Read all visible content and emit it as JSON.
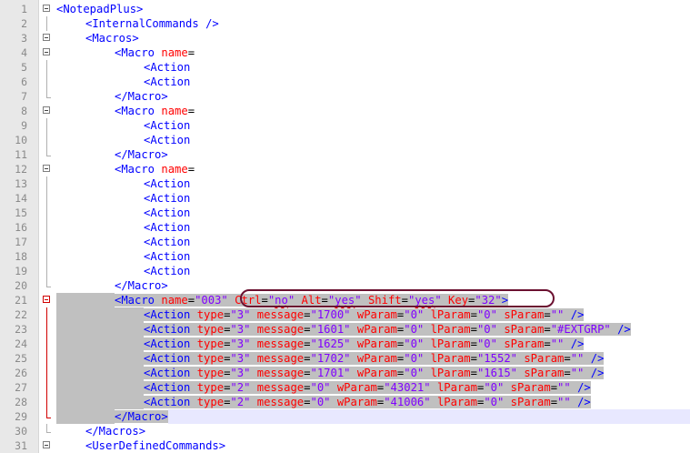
{
  "lines": [
    {
      "n": "1",
      "indent": 0,
      "sel": false,
      "fold": "box",
      "tokens": [
        {
          "t": "<NotepadPlus>",
          "c": "tag"
        }
      ]
    },
    {
      "n": "2",
      "indent": 1,
      "sel": false,
      "fold": "",
      "tokens": [
        {
          "t": "<InternalCommands />",
          "c": "tag"
        }
      ]
    },
    {
      "n": "3",
      "indent": 1,
      "sel": false,
      "fold": "box",
      "tokens": [
        {
          "t": "<Macros>",
          "c": "tag"
        }
      ]
    },
    {
      "n": "4",
      "indent": 2,
      "sel": false,
      "fold": "box",
      "tokens": [
        {
          "t": "<Macro ",
          "c": "tag"
        },
        {
          "t": "name",
          "c": "attr"
        },
        {
          "t": "=",
          "c": "eq"
        }
      ]
    },
    {
      "n": "5",
      "indent": 3,
      "sel": false,
      "fold": "",
      "tokens": [
        {
          "t": "<Action",
          "c": "tag"
        }
      ]
    },
    {
      "n": "6",
      "indent": 3,
      "sel": false,
      "fold": "",
      "tokens": [
        {
          "t": "<Action",
          "c": "tag"
        }
      ]
    },
    {
      "n": "7",
      "indent": 2,
      "sel": false,
      "fold": "end",
      "tokens": [
        {
          "t": "</Macro>",
          "c": "tag"
        }
      ]
    },
    {
      "n": "8",
      "indent": 2,
      "sel": false,
      "fold": "box",
      "tokens": [
        {
          "t": "<Macro ",
          "c": "tag"
        },
        {
          "t": "name",
          "c": "attr"
        },
        {
          "t": "=",
          "c": "eq"
        }
      ]
    },
    {
      "n": "9",
      "indent": 3,
      "sel": false,
      "fold": "",
      "tokens": [
        {
          "t": "<Action",
          "c": "tag"
        }
      ]
    },
    {
      "n": "10",
      "indent": 3,
      "sel": false,
      "fold": "",
      "tokens": [
        {
          "t": "<Action",
          "c": "tag"
        }
      ]
    },
    {
      "n": "11",
      "indent": 2,
      "sel": false,
      "fold": "end",
      "tokens": [
        {
          "t": "</Macro>",
          "c": "tag"
        }
      ]
    },
    {
      "n": "12",
      "indent": 2,
      "sel": false,
      "fold": "box",
      "tokens": [
        {
          "t": "<Macro ",
          "c": "tag"
        },
        {
          "t": "name",
          "c": "attr"
        },
        {
          "t": "=",
          "c": "eq"
        }
      ]
    },
    {
      "n": "13",
      "indent": 3,
      "sel": false,
      "fold": "",
      "tokens": [
        {
          "t": "<Action",
          "c": "tag"
        }
      ]
    },
    {
      "n": "14",
      "indent": 3,
      "sel": false,
      "fold": "",
      "tokens": [
        {
          "t": "<Action",
          "c": "tag"
        }
      ]
    },
    {
      "n": "15",
      "indent": 3,
      "sel": false,
      "fold": "",
      "tokens": [
        {
          "t": "<Action",
          "c": "tag"
        }
      ]
    },
    {
      "n": "16",
      "indent": 3,
      "sel": false,
      "fold": "",
      "tokens": [
        {
          "t": "<Action",
          "c": "tag"
        }
      ]
    },
    {
      "n": "17",
      "indent": 3,
      "sel": false,
      "fold": "",
      "tokens": [
        {
          "t": "<Action",
          "c": "tag"
        }
      ]
    },
    {
      "n": "18",
      "indent": 3,
      "sel": false,
      "fold": "",
      "tokens": [
        {
          "t": "<Action",
          "c": "tag"
        }
      ]
    },
    {
      "n": "19",
      "indent": 3,
      "sel": false,
      "fold": "",
      "tokens": [
        {
          "t": "<Action",
          "c": "tag"
        }
      ]
    },
    {
      "n": "20",
      "indent": 2,
      "sel": false,
      "fold": "end",
      "tokens": [
        {
          "t": "</Macro>",
          "c": "tag"
        }
      ]
    },
    {
      "n": "21",
      "indent": 2,
      "sel": true,
      "fold": "redbox",
      "tokens": [
        {
          "t": "<Macro ",
          "c": "tag"
        },
        {
          "t": "name",
          "c": "attr"
        },
        {
          "t": "=",
          "c": "eq"
        },
        {
          "t": "\"003\"",
          "c": "val"
        },
        {
          "t": " ",
          "c": "eq"
        },
        {
          "t": "Ctrl",
          "c": "attr"
        },
        {
          "t": "=",
          "c": "eq"
        },
        {
          "t": "\"",
          "c": "val"
        },
        {
          "t": "no",
          "c": "val",
          "sq": true
        },
        {
          "t": "\"",
          "c": "val"
        },
        {
          "t": " ",
          "c": "eq"
        },
        {
          "t": "Alt",
          "c": "attr"
        },
        {
          "t": "=",
          "c": "eq"
        },
        {
          "t": "\"",
          "c": "val"
        },
        {
          "t": "yes",
          "c": "val",
          "sq": true
        },
        {
          "t": "\"",
          "c": "val"
        },
        {
          "t": " ",
          "c": "eq"
        },
        {
          "t": "Shift",
          "c": "attr"
        },
        {
          "t": "=",
          "c": "eq"
        },
        {
          "t": "\"",
          "c": "val"
        },
        {
          "t": "yes",
          "c": "val",
          "sq": true
        },
        {
          "t": "\"",
          "c": "val"
        },
        {
          "t": " ",
          "c": "eq"
        },
        {
          "t": "Key",
          "c": "attr"
        },
        {
          "t": "=",
          "c": "eq"
        },
        {
          "t": "\"32\"",
          "c": "val"
        },
        {
          "t": ">",
          "c": "tag"
        }
      ]
    },
    {
      "n": "22",
      "indent": 3,
      "sel": true,
      "fold": "red",
      "tokens": [
        {
          "t": "<Action ",
          "c": "tag"
        },
        {
          "t": "type",
          "c": "attr"
        },
        {
          "t": "=",
          "c": "eq"
        },
        {
          "t": "\"3\"",
          "c": "val"
        },
        {
          "t": " ",
          "c": "eq"
        },
        {
          "t": "message",
          "c": "attr"
        },
        {
          "t": "=",
          "c": "eq"
        },
        {
          "t": "\"1700\"",
          "c": "val"
        },
        {
          "t": " ",
          "c": "eq"
        },
        {
          "t": "wParam",
          "c": "attr"
        },
        {
          "t": "=",
          "c": "eq"
        },
        {
          "t": "\"0\"",
          "c": "val"
        },
        {
          "t": " ",
          "c": "eq"
        },
        {
          "t": "lParam",
          "c": "attr"
        },
        {
          "t": "=",
          "c": "eq"
        },
        {
          "t": "\"0\"",
          "c": "val"
        },
        {
          "t": " ",
          "c": "eq"
        },
        {
          "t": "sParam",
          "c": "attr"
        },
        {
          "t": "=",
          "c": "eq"
        },
        {
          "t": "\"\"",
          "c": "val"
        },
        {
          "t": " />",
          "c": "tag"
        }
      ]
    },
    {
      "n": "23",
      "indent": 3,
      "sel": true,
      "fold": "red",
      "tokens": [
        {
          "t": "<Action ",
          "c": "tag"
        },
        {
          "t": "type",
          "c": "attr"
        },
        {
          "t": "=",
          "c": "eq"
        },
        {
          "t": "\"3\"",
          "c": "val"
        },
        {
          "t": " ",
          "c": "eq"
        },
        {
          "t": "message",
          "c": "attr"
        },
        {
          "t": "=",
          "c": "eq"
        },
        {
          "t": "\"1601\"",
          "c": "val"
        },
        {
          "t": " ",
          "c": "eq"
        },
        {
          "t": "wParam",
          "c": "attr"
        },
        {
          "t": "=",
          "c": "eq"
        },
        {
          "t": "\"0\"",
          "c": "val"
        },
        {
          "t": " ",
          "c": "eq"
        },
        {
          "t": "lParam",
          "c": "attr"
        },
        {
          "t": "=",
          "c": "eq"
        },
        {
          "t": "\"0\"",
          "c": "val"
        },
        {
          "t": " ",
          "c": "eq"
        },
        {
          "t": "sParam",
          "c": "attr"
        },
        {
          "t": "=",
          "c": "eq"
        },
        {
          "t": "\"#EXTGRP\"",
          "c": "val"
        },
        {
          "t": " />",
          "c": "tag"
        }
      ]
    },
    {
      "n": "24",
      "indent": 3,
      "sel": true,
      "fold": "red",
      "tokens": [
        {
          "t": "<Action ",
          "c": "tag"
        },
        {
          "t": "type",
          "c": "attr"
        },
        {
          "t": "=",
          "c": "eq"
        },
        {
          "t": "\"3\"",
          "c": "val"
        },
        {
          "t": " ",
          "c": "eq"
        },
        {
          "t": "message",
          "c": "attr"
        },
        {
          "t": "=",
          "c": "eq"
        },
        {
          "t": "\"1625\"",
          "c": "val"
        },
        {
          "t": " ",
          "c": "eq"
        },
        {
          "t": "wParam",
          "c": "attr"
        },
        {
          "t": "=",
          "c": "eq"
        },
        {
          "t": "\"0\"",
          "c": "val"
        },
        {
          "t": " ",
          "c": "eq"
        },
        {
          "t": "lParam",
          "c": "attr"
        },
        {
          "t": "=",
          "c": "eq"
        },
        {
          "t": "\"0\"",
          "c": "val"
        },
        {
          "t": " ",
          "c": "eq"
        },
        {
          "t": "sParam",
          "c": "attr"
        },
        {
          "t": "=",
          "c": "eq"
        },
        {
          "t": "\"\"",
          "c": "val"
        },
        {
          "t": " />",
          "c": "tag"
        }
      ]
    },
    {
      "n": "25",
      "indent": 3,
      "sel": true,
      "fold": "red",
      "tokens": [
        {
          "t": "<Action ",
          "c": "tag"
        },
        {
          "t": "type",
          "c": "attr"
        },
        {
          "t": "=",
          "c": "eq"
        },
        {
          "t": "\"3\"",
          "c": "val"
        },
        {
          "t": " ",
          "c": "eq"
        },
        {
          "t": "message",
          "c": "attr"
        },
        {
          "t": "=",
          "c": "eq"
        },
        {
          "t": "\"1702\"",
          "c": "val"
        },
        {
          "t": " ",
          "c": "eq"
        },
        {
          "t": "wParam",
          "c": "attr"
        },
        {
          "t": "=",
          "c": "eq"
        },
        {
          "t": "\"0\"",
          "c": "val"
        },
        {
          "t": " ",
          "c": "eq"
        },
        {
          "t": "lParam",
          "c": "attr"
        },
        {
          "t": "=",
          "c": "eq"
        },
        {
          "t": "\"1552\"",
          "c": "val"
        },
        {
          "t": " ",
          "c": "eq"
        },
        {
          "t": "sParam",
          "c": "attr"
        },
        {
          "t": "=",
          "c": "eq"
        },
        {
          "t": "\"\"",
          "c": "val"
        },
        {
          "t": " />",
          "c": "tag"
        }
      ]
    },
    {
      "n": "26",
      "indent": 3,
      "sel": true,
      "fold": "red",
      "tokens": [
        {
          "t": "<Action ",
          "c": "tag"
        },
        {
          "t": "type",
          "c": "attr"
        },
        {
          "t": "=",
          "c": "eq"
        },
        {
          "t": "\"3\"",
          "c": "val"
        },
        {
          "t": " ",
          "c": "eq"
        },
        {
          "t": "message",
          "c": "attr"
        },
        {
          "t": "=",
          "c": "eq"
        },
        {
          "t": "\"1701\"",
          "c": "val"
        },
        {
          "t": " ",
          "c": "eq"
        },
        {
          "t": "wParam",
          "c": "attr"
        },
        {
          "t": "=",
          "c": "eq"
        },
        {
          "t": "\"0\"",
          "c": "val"
        },
        {
          "t": " ",
          "c": "eq"
        },
        {
          "t": "lParam",
          "c": "attr"
        },
        {
          "t": "=",
          "c": "eq"
        },
        {
          "t": "\"1615\"",
          "c": "val"
        },
        {
          "t": " ",
          "c": "eq"
        },
        {
          "t": "sParam",
          "c": "attr"
        },
        {
          "t": "=",
          "c": "eq"
        },
        {
          "t": "\"\"",
          "c": "val"
        },
        {
          "t": " />",
          "c": "tag"
        }
      ]
    },
    {
      "n": "27",
      "indent": 3,
      "sel": true,
      "fold": "red",
      "tokens": [
        {
          "t": "<Action ",
          "c": "tag"
        },
        {
          "t": "type",
          "c": "attr"
        },
        {
          "t": "=",
          "c": "eq"
        },
        {
          "t": "\"2\"",
          "c": "val"
        },
        {
          "t": " ",
          "c": "eq"
        },
        {
          "t": "message",
          "c": "attr"
        },
        {
          "t": "=",
          "c": "eq"
        },
        {
          "t": "\"0\"",
          "c": "val"
        },
        {
          "t": " ",
          "c": "eq"
        },
        {
          "t": "wParam",
          "c": "attr"
        },
        {
          "t": "=",
          "c": "eq"
        },
        {
          "t": "\"43021\"",
          "c": "val"
        },
        {
          "t": " ",
          "c": "eq"
        },
        {
          "t": "lParam",
          "c": "attr"
        },
        {
          "t": "=",
          "c": "eq"
        },
        {
          "t": "\"0\"",
          "c": "val"
        },
        {
          "t": " ",
          "c": "eq"
        },
        {
          "t": "sParam",
          "c": "attr"
        },
        {
          "t": "=",
          "c": "eq"
        },
        {
          "t": "\"\"",
          "c": "val"
        },
        {
          "t": " />",
          "c": "tag"
        }
      ]
    },
    {
      "n": "28",
      "indent": 3,
      "sel": true,
      "fold": "red",
      "tokens": [
        {
          "t": "<Action ",
          "c": "tag"
        },
        {
          "t": "type",
          "c": "attr"
        },
        {
          "t": "=",
          "c": "eq"
        },
        {
          "t": "\"2\"",
          "c": "val"
        },
        {
          "t": " ",
          "c": "eq"
        },
        {
          "t": "message",
          "c": "attr"
        },
        {
          "t": "=",
          "c": "eq"
        },
        {
          "t": "\"0\"",
          "c": "val"
        },
        {
          "t": " ",
          "c": "eq"
        },
        {
          "t": "wParam",
          "c": "attr"
        },
        {
          "t": "=",
          "c": "eq"
        },
        {
          "t": "\"41006\"",
          "c": "val"
        },
        {
          "t": " ",
          "c": "eq"
        },
        {
          "t": "lParam",
          "c": "attr"
        },
        {
          "t": "=",
          "c": "eq"
        },
        {
          "t": "\"0\"",
          "c": "val"
        },
        {
          "t": " ",
          "c": "eq"
        },
        {
          "t": "sParam",
          "c": "attr"
        },
        {
          "t": "=",
          "c": "eq"
        },
        {
          "t": "\"\"",
          "c": "val"
        },
        {
          "t": " />",
          "c": "tag"
        }
      ]
    },
    {
      "n": "29",
      "indent": 2,
      "sel": true,
      "fold": "redend",
      "caret": true,
      "tokens": [
        {
          "t": "</Macro>",
          "c": "tag"
        }
      ]
    },
    {
      "n": "30",
      "indent": 1,
      "sel": false,
      "fold": "end",
      "tokens": [
        {
          "t": "</Macros>",
          "c": "tag"
        }
      ]
    },
    {
      "n": "31",
      "indent": 1,
      "sel": false,
      "fold": "box",
      "tokens": [
        {
          "t": "<UserDefinedCommands>",
          "c": "tag"
        }
      ]
    }
  ]
}
